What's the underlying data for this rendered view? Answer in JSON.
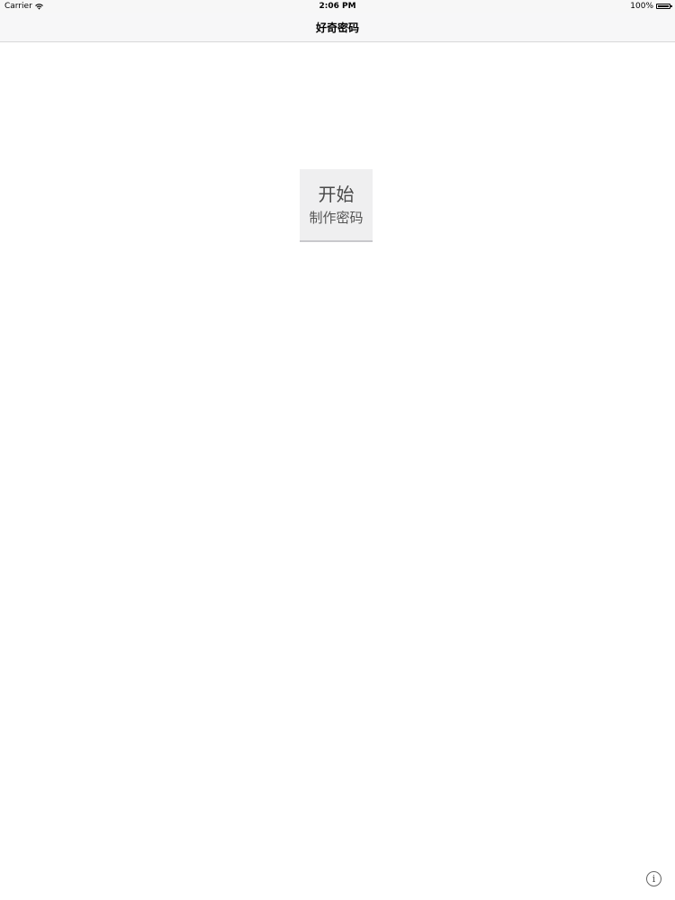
{
  "status_bar": {
    "carrier": "Carrier",
    "time": "2:06 PM",
    "battery": "100%",
    "wifi_icon": "wifi-icon",
    "battery_icon": "battery-icon"
  },
  "nav_bar": {
    "title": "好奇密码"
  },
  "main": {
    "start_button": {
      "line1": "开始",
      "line2": "制作密码"
    }
  },
  "footer": {
    "info_icon": "info-icon",
    "info_glyph": "i"
  }
}
